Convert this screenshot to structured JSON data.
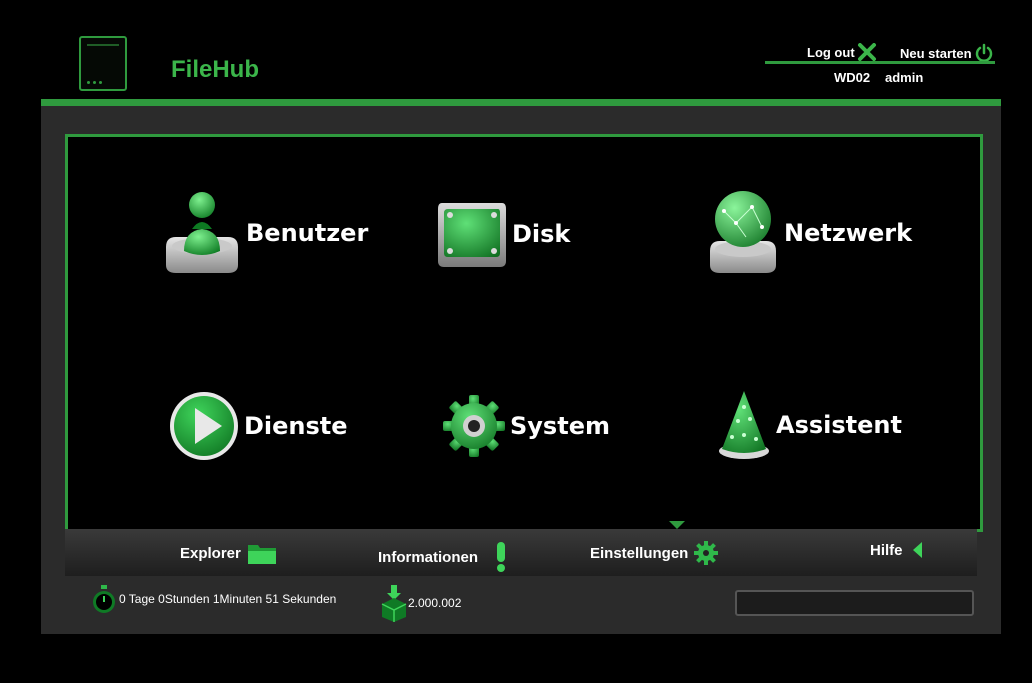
{
  "header": {
    "app_title": "FileHub",
    "logout_label": "Log out",
    "restart_label": "Neu starten",
    "device_name": "WD02",
    "user_name": "admin"
  },
  "tiles": [
    {
      "label": "Benutzer",
      "icon": "user-icon"
    },
    {
      "label": "Disk",
      "icon": "disk-icon"
    },
    {
      "label": "Netzwerk",
      "icon": "globe-icon"
    },
    {
      "label": "Dienste",
      "icon": "play-icon"
    },
    {
      "label": "System",
      "icon": "gear-icon"
    },
    {
      "label": "Assistent",
      "icon": "wizard-hat-icon"
    }
  ],
  "nav": {
    "explorer": "Explorer",
    "informationen": "Informationen",
    "einstellungen": "Einstellungen",
    "hilfe": "Hilfe"
  },
  "status": {
    "uptime": "0 Tage 0Stunden 1Minuten 51 Sekunden",
    "version": "2.000.002"
  },
  "colors": {
    "accent": "#2f9a3e",
    "title": "#3bb54a",
    "background": "#000000",
    "panel": "#2b2b2b"
  }
}
